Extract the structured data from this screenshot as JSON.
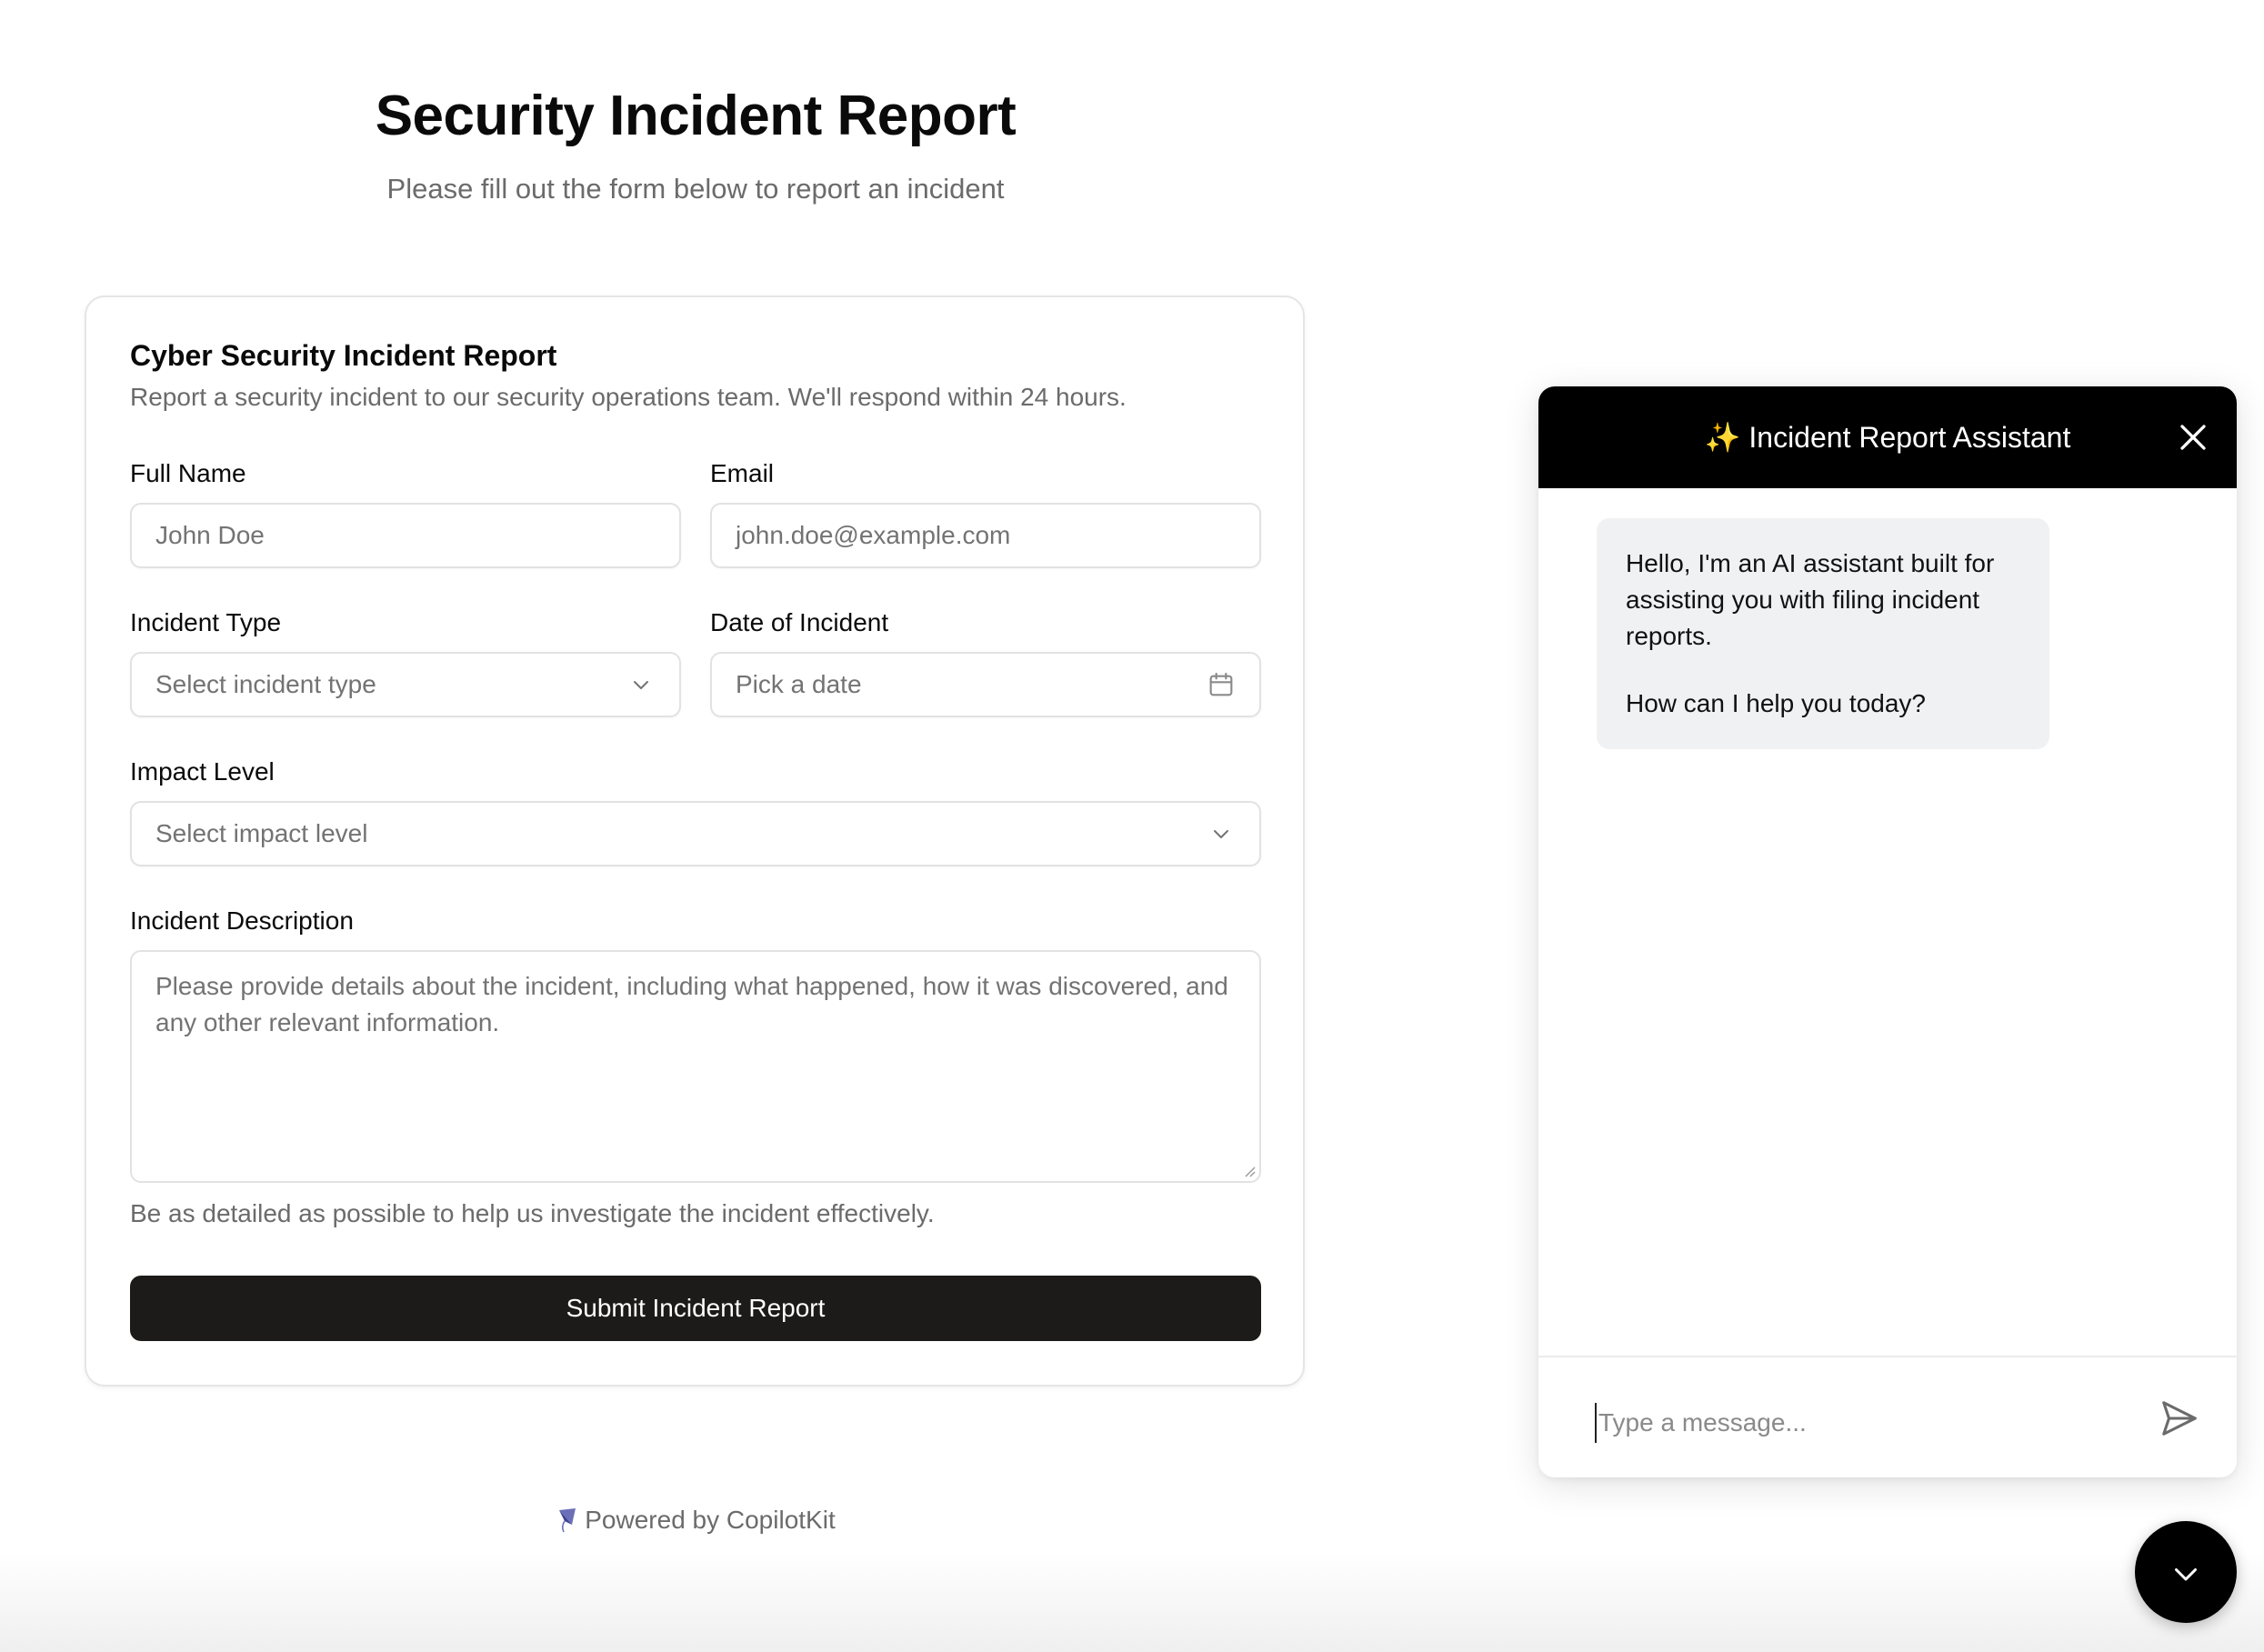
{
  "header": {
    "title": "Security Incident Report",
    "subtitle": "Please fill out the form below to report an incident"
  },
  "form": {
    "title": "Cyber Security Incident Report",
    "description": "Report a security incident to our security operations team. We'll respond within 24 hours.",
    "full_name": {
      "label": "Full Name",
      "placeholder": "John Doe"
    },
    "email": {
      "label": "Email",
      "placeholder": "john.doe@example.com"
    },
    "incident_type": {
      "label": "Incident Type",
      "placeholder": "Select incident type",
      "icon": "chevron-down-icon"
    },
    "date": {
      "label": "Date of Incident",
      "placeholder": "Pick a date",
      "icon": "calendar-icon"
    },
    "impact_level": {
      "label": "Impact Level",
      "placeholder": "Select impact level",
      "icon": "chevron-down-icon"
    },
    "description_field": {
      "label": "Incident Description",
      "placeholder": "Please provide details about the incident, including what happened, how it was discovered, and any other relevant information.",
      "helper": "Be as detailed as possible to help us investigate the incident effectively."
    },
    "submit_label": "Submit Incident Report"
  },
  "footer": {
    "powered_by": "Powered by CopilotKit",
    "icon": "kite-icon"
  },
  "chat": {
    "title": "✨ Incident Report Assistant",
    "close_icon": "close-icon",
    "messages": [
      {
        "role": "assistant",
        "lines": [
          "Hello, I'm an AI assistant built for assisting you with filing incident reports.",
          "How can I help you today?"
        ]
      }
    ],
    "input_placeholder": "Type a message...",
    "send_icon": "send-icon",
    "toggle_icon": "chevron-down-icon"
  },
  "colors": {
    "primary_button": "#1c1b1a",
    "chat_header": "#000000",
    "bubble_bg": "#f0f1f3",
    "muted_text": "#6b6b6b",
    "border": "#e2e2e2"
  }
}
